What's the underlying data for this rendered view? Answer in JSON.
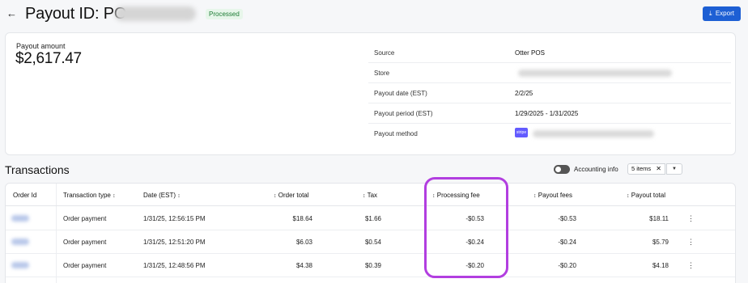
{
  "header": {
    "back_icon": "arrow-left-icon",
    "title": "Payout ID: PO-",
    "status": "Processed",
    "export_label": "Export",
    "export_icon": "download-icon"
  },
  "summary": {
    "amount_label": "Payout amount",
    "amount_value": "$2,617.47",
    "details": [
      {
        "label": "Source",
        "value": "Otter POS"
      },
      {
        "label": "Store",
        "value": ""
      },
      {
        "label": "Payout date (EST)",
        "value": "2/2/25"
      },
      {
        "label": "Payout period (EST)",
        "value": "1/29/2025 - 1/31/2025"
      },
      {
        "label": "Payout method",
        "value": "",
        "logo": "stripe"
      }
    ]
  },
  "transactions": {
    "title": "Transactions",
    "accounting_info_label": "Accounting info",
    "items_filter": "5 items",
    "columns": [
      "Order Id",
      "Transaction type",
      "Date (EST)",
      "Order total",
      "Tax",
      "Processing fee",
      "Payout fees",
      "Payout total"
    ],
    "rows": [
      {
        "type": "Order payment",
        "date": "1/31/25, 12:56:15 PM",
        "order_total": "$18.64",
        "tax": "$1.66",
        "processing_fee": "-$0.53",
        "payout_fees": "-$0.53",
        "payout_total": "$18.11"
      },
      {
        "type": "Order payment",
        "date": "1/31/25, 12:51:20 PM",
        "order_total": "$6.03",
        "tax": "$0.54",
        "processing_fee": "-$0.24",
        "payout_fees": "-$0.24",
        "payout_total": "$5.79"
      },
      {
        "type": "Order payment",
        "date": "1/31/25, 12:48:56 PM",
        "order_total": "$4.38",
        "tax": "$0.39",
        "processing_fee": "-$0.20",
        "payout_fees": "-$0.20",
        "payout_total": "$4.18"
      }
    ]
  },
  "colors": {
    "accent": "#1d5fd4",
    "success_text": "#1b7b33",
    "highlight": "#b23ee0",
    "stripe": "#635bff"
  }
}
